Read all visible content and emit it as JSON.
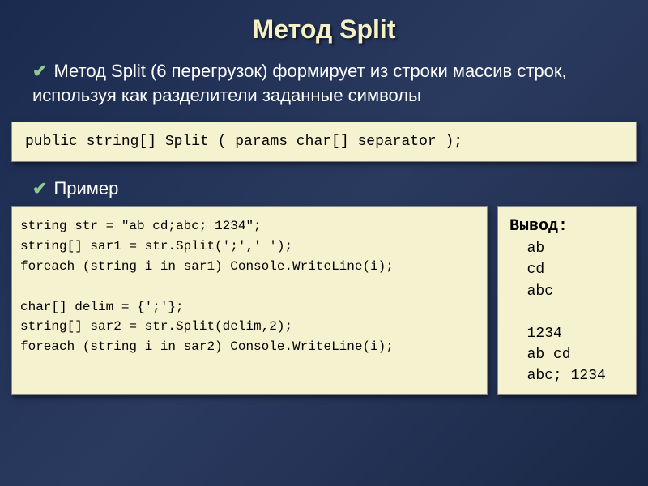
{
  "title": "Метод Split",
  "intro_text": "Метод  Split  (6 перегрузок)  формирует из строки массив строк, используя как разделители заданные символы",
  "signature": "public string[] Split ( params char[] separator );",
  "example_label": "Пример",
  "example_code": "string str = \"ab cd;abc; 1234\";\nstring[] sar1 = str.Split(';',' ');\nforeach (string i in sar1) Console.WriteLine(i);\n\nchar[] delim = {';'};\nstring[] sar2 = str.Split(delim,2);\nforeach (string i in sar2) Console.WriteLine(i);",
  "output": {
    "header": "Вывод:",
    "lines": "  ab\n  cd\n  abc\n\n  1234\n  ab cd\n  abc; 1234"
  }
}
